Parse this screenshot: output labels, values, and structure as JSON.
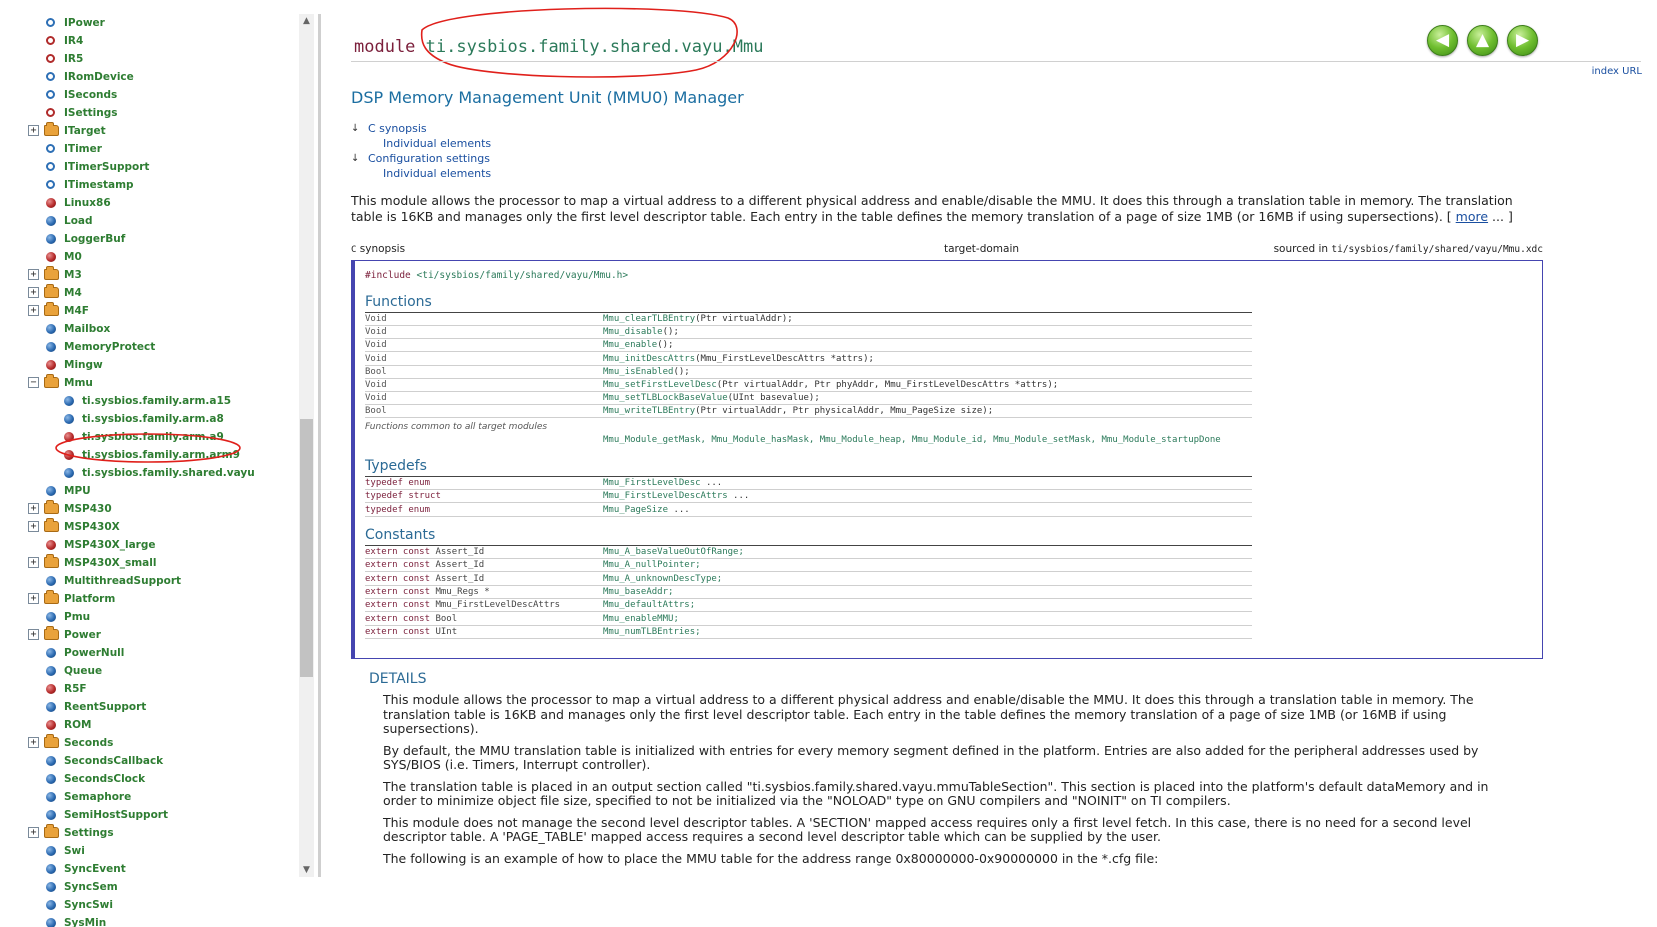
{
  "sidebar": {
    "items": [
      {
        "label": "IPower",
        "icon": "ring-blue"
      },
      {
        "label": "IR4",
        "icon": "ring-red"
      },
      {
        "label": "IR5",
        "icon": "ring-red"
      },
      {
        "label": "IRomDevice",
        "icon": "ring-blue"
      },
      {
        "label": "ISeconds",
        "icon": "ring-blue"
      },
      {
        "label": "ISettings",
        "icon": "ring-red"
      },
      {
        "label": "ITarget",
        "icon": "folder",
        "expander": "+"
      },
      {
        "label": "ITimer",
        "icon": "ring-blue"
      },
      {
        "label": "ITimerSupport",
        "icon": "ring-blue"
      },
      {
        "label": "ITimestamp",
        "icon": "ring-blue"
      },
      {
        "label": "Linux86",
        "icon": "dot-red"
      },
      {
        "label": "Load",
        "icon": "dot-blue"
      },
      {
        "label": "LoggerBuf",
        "icon": "dot-blue"
      },
      {
        "label": "M0",
        "icon": "dot-red"
      },
      {
        "label": "M3",
        "icon": "folder",
        "expander": "+"
      },
      {
        "label": "M4",
        "icon": "folder",
        "expander": "+"
      },
      {
        "label": "M4F",
        "icon": "folder",
        "expander": "+"
      },
      {
        "label": "Mailbox",
        "icon": "dot-blue"
      },
      {
        "label": "MemoryProtect",
        "icon": "dot-blue"
      },
      {
        "label": "Mingw",
        "icon": "dot-red"
      },
      {
        "label": "Mmu",
        "icon": "folder",
        "expander": "−"
      },
      {
        "label": "ti.sysbios.family.arm.a15",
        "icon": "dot-blue",
        "child": true
      },
      {
        "label": "ti.sysbios.family.arm.a8",
        "icon": "dot-blue",
        "child": true
      },
      {
        "label": "ti.sysbios.family.arm.a9",
        "icon": "dot-red",
        "child": true
      },
      {
        "label": "ti.sysbios.family.arm.arm9",
        "icon": "dot-red",
        "child": true
      },
      {
        "label": "ti.sysbios.family.shared.vayu",
        "icon": "dot-blue",
        "child": true,
        "selected": true
      },
      {
        "label": "MPU",
        "icon": "dot-blue"
      },
      {
        "label": "MSP430",
        "icon": "folder",
        "expander": "+"
      },
      {
        "label": "MSP430X",
        "icon": "folder",
        "expander": "+"
      },
      {
        "label": "MSP430X_large",
        "icon": "dot-red"
      },
      {
        "label": "MSP430X_small",
        "icon": "folder",
        "expander": "+"
      },
      {
        "label": "MultithreadSupport",
        "icon": "dot-blue"
      },
      {
        "label": "Platform",
        "icon": "folder",
        "expander": "+"
      },
      {
        "label": "Pmu",
        "icon": "dot-blue"
      },
      {
        "label": "Power",
        "icon": "folder",
        "expander": "+"
      },
      {
        "label": "PowerNull",
        "icon": "dot-blue"
      },
      {
        "label": "Queue",
        "icon": "dot-blue"
      },
      {
        "label": "R5F",
        "icon": "dot-red"
      },
      {
        "label": "ReentSupport",
        "icon": "dot-blue"
      },
      {
        "label": "ROM",
        "icon": "dot-red"
      },
      {
        "label": "Seconds",
        "icon": "folder",
        "expander": "+"
      },
      {
        "label": "SecondsCallback",
        "icon": "dot-blue"
      },
      {
        "label": "SecondsClock",
        "icon": "dot-blue"
      },
      {
        "label": "Semaphore",
        "icon": "dot-blue"
      },
      {
        "label": "SemiHostSupport",
        "icon": "dot-blue"
      },
      {
        "label": "Settings",
        "icon": "folder",
        "expander": "+"
      },
      {
        "label": "Swi",
        "icon": "dot-blue"
      },
      {
        "label": "SyncEvent",
        "icon": "dot-blue"
      },
      {
        "label": "SyncSem",
        "icon": "dot-blue"
      },
      {
        "label": "SyncSwi",
        "icon": "dot-blue"
      },
      {
        "label": "SysMin",
        "icon": "dot-blue"
      }
    ]
  },
  "header": {
    "keyword": "module",
    "module_name": "ti.sysbios.family.shared.vayu.Mmu",
    "index_url": "index URL",
    "nav": {
      "back": "back-arrow",
      "up": "up-arrow",
      "forward": "forward-arrow"
    }
  },
  "subtitle": "DSP Memory Management Unit (MMU0) Manager",
  "toc": {
    "c_synopsis": "C synopsis",
    "c_individual": "Individual elements",
    "config": "Configuration settings",
    "config_individual": "Individual elements"
  },
  "intro": {
    "text": "This module allows the processor to map a virtual address to a different physical address and enable/disable the MMU. It does this through a translation table in memory. The translation table is 16KB and manages only the first level descriptor table. Each entry in the table defines the memory translation of a page of size 1MB (or 16MB if using supersections).",
    "more_open": "[",
    "more": "more",
    "more_close": "... ]"
  },
  "synopsis": {
    "c_mark": "C",
    "label": "synopsis",
    "domain": "target-domain",
    "sourced_prefix": "sourced in",
    "sourced_path": "ti/sysbios/family/shared/vayu/Mmu.xdc",
    "include_kw": "#include",
    "include_path": "<ti/sysbios/family/shared/vayu/Mmu.h>",
    "functions_title": "Functions",
    "functions": [
      {
        "type": "Void",
        "name": "Mmu_clearTLBEntry",
        "args": "(Ptr virtualAddr);"
      },
      {
        "type": "Void",
        "name": "Mmu_disable",
        "args": "();"
      },
      {
        "type": "Void",
        "name": "Mmu_enable",
        "args": "();"
      },
      {
        "type": "Void",
        "name": "Mmu_initDescAttrs",
        "args": "(Mmu_FirstLevelDescAttrs *attrs);"
      },
      {
        "type": "Bool",
        "name": "Mmu_isEnabled",
        "args": "();"
      },
      {
        "type": "Void",
        "name": "Mmu_setFirstLevelDesc",
        "args": "(Ptr virtualAddr, Ptr phyAddr, Mmu_FirstLevelDescAttrs *attrs);"
      },
      {
        "type": "Void",
        "name": "Mmu_setTLBLockBaseValue",
        "args": "(UInt basevalue);"
      },
      {
        "type": "Bool",
        "name": "Mmu_writeTLBEntry",
        "args": "(Ptr virtualAddr, Ptr physicalAddr, Mmu_PageSize size);"
      }
    ],
    "common_label": "Functions common to all target modules",
    "common_functions": "Mmu_Module_getMask, Mmu_Module_hasMask, Mmu_Module_heap, Mmu_Module_id, Mmu_Module_setMask, Mmu_Module_startupDone",
    "typedefs_title": "Typedefs",
    "typedefs": [
      {
        "kind": "typedef enum",
        "name": "Mmu_FirstLevelDesc",
        "rest": " ..."
      },
      {
        "kind": "typedef struct",
        "name": "Mmu_FirstLevelDescAttrs",
        "rest": " ..."
      },
      {
        "kind": "typedef enum",
        "name": "Mmu_PageSize",
        "rest": " ..."
      }
    ],
    "constants_title": "Constants",
    "constants": [
      {
        "kw": "extern const",
        "type": " Assert_Id",
        "name": "Mmu_A_baseValueOutOfRange;"
      },
      {
        "kw": "extern const",
        "type": " Assert_Id",
        "name": "Mmu_A_nullPointer;"
      },
      {
        "kw": "extern const",
        "type": " Assert_Id",
        "name": "Mmu_A_unknownDescType;"
      },
      {
        "kw": "extern const",
        "type": " Mmu_Regs *",
        "name": "Mmu_baseAddr;"
      },
      {
        "kw": "extern const",
        "type": " Mmu_FirstLevelDescAttrs",
        "name": "Mmu_defaultAttrs;"
      },
      {
        "kw": "extern const",
        "type": " Bool",
        "name": "Mmu_enableMMU;"
      },
      {
        "kw": "extern const",
        "type": " UInt",
        "name": "Mmu_numTLBEntries;"
      }
    ]
  },
  "details": {
    "title": "DETAILS",
    "paragraphs": [
      "This module allows the processor to map a virtual address to a different physical address and enable/disable the MMU. It does this through a translation table in memory. The translation table is 16KB and manages only the first level descriptor table. Each entry in the table defines the memory translation of a page of size 1MB (or 16MB if using supersections).",
      "By default, the MMU translation table is initialized with entries for every memory segment defined in the platform. Entries are also added for the peripheral addresses used by SYS/BIOS (i.e. Timers, Interrupt controller).",
      "The translation table is placed in an output section called \"ti.sysbios.family.shared.vayu.mmuTableSection\". This section is placed into the platform's default dataMemory and in order to minimize object file size, specified to not be initialized via the \"NOLOAD\" type on GNU compilers and \"NOINIT\" on TI compilers.",
      "This module does not manage the second level descriptor tables. A 'SECTION' mapped access requires only a first level fetch. In this case, there is no need for a second level descriptor table. A 'PAGE_TABLE' mapped access requires a second level descriptor table which can be supplied by the user.",
      "The following is an example of how to place the MMU table for the address range 0x80000000-0x90000000 in the *.cfg file:"
    ]
  },
  "colors": {
    "annotation": "#e0201b",
    "tree_text": "#2e7d32",
    "link": "#1a4fa0",
    "section_heading": "#2b6a95",
    "synopsis_border": "#4545b0"
  }
}
